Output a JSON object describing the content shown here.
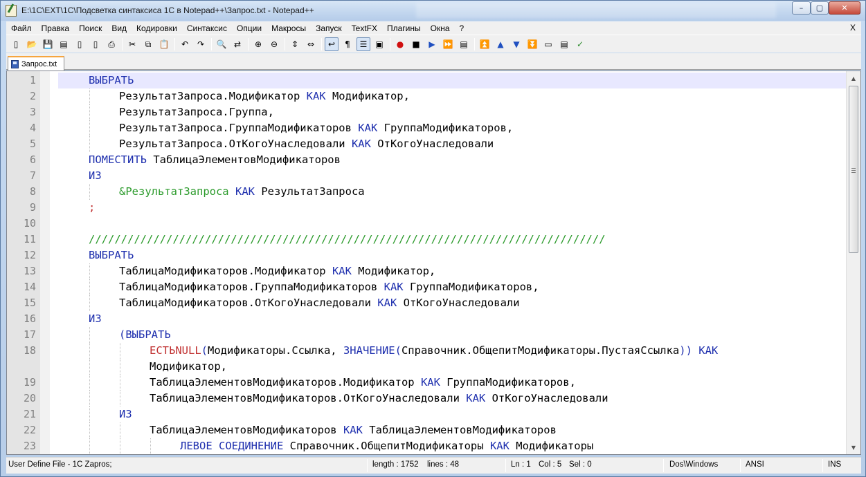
{
  "window": {
    "title": "E:\\1C\\EXT\\1C\\Подсветка синтаксиса 1С в Notepad++\\Запрос.txt - Notepad++",
    "minimize_glyph": "–",
    "maximize_glyph": "▢",
    "close_glyph": "✕"
  },
  "menu": {
    "items": [
      "Файл",
      "Правка",
      "Поиск",
      "Вид",
      "Кодировки",
      "Синтаксис",
      "Опции",
      "Макросы",
      "Запуск",
      "TextFX",
      "Плагины",
      "Окна",
      "?"
    ],
    "close_glyph": "X"
  },
  "toolbar": {
    "icons": [
      {
        "name": "new-file-icon",
        "glyph": "▯"
      },
      {
        "name": "open-file-icon",
        "glyph": "📂"
      },
      {
        "name": "save-icon",
        "glyph": "💾"
      },
      {
        "name": "save-all-icon",
        "glyph": "▤"
      },
      {
        "name": "close-file-icon",
        "glyph": "▯"
      },
      {
        "name": "close-all-icon",
        "glyph": "▯"
      },
      {
        "name": "print-icon",
        "glyph": "⎙"
      },
      {
        "sep": true
      },
      {
        "name": "cut-icon",
        "glyph": "✂"
      },
      {
        "name": "copy-icon",
        "glyph": "⧉"
      },
      {
        "name": "paste-icon",
        "glyph": "📋"
      },
      {
        "sep": true
      },
      {
        "name": "undo-icon",
        "glyph": "↶"
      },
      {
        "name": "redo-icon",
        "glyph": "↷"
      },
      {
        "sep": true
      },
      {
        "name": "find-icon",
        "glyph": "🔍"
      },
      {
        "name": "replace-icon",
        "glyph": "⇄"
      },
      {
        "sep": true
      },
      {
        "name": "zoom-in-icon",
        "glyph": "⊕"
      },
      {
        "name": "zoom-out-icon",
        "glyph": "⊖"
      },
      {
        "sep": true
      },
      {
        "name": "sync-vertical-icon",
        "glyph": "⇕"
      },
      {
        "name": "sync-horizontal-icon",
        "glyph": "⇔"
      },
      {
        "sep": true
      },
      {
        "name": "word-wrap-icon",
        "glyph": "↩",
        "active": true
      },
      {
        "name": "show-all-chars-icon",
        "glyph": "¶"
      },
      {
        "name": "indent-guide-icon",
        "glyph": "☰",
        "active": true
      },
      {
        "name": "language-icon",
        "glyph": "▣"
      },
      {
        "sep": true
      },
      {
        "name": "record-macro-icon",
        "glyph": "●",
        "color": "#d01010"
      },
      {
        "name": "stop-record-icon",
        "glyph": "■"
      },
      {
        "name": "play-macro-icon",
        "glyph": "▶",
        "color": "#2050c0"
      },
      {
        "name": "run-macro-multiple-icon",
        "glyph": "⏩",
        "color": "#2050c0"
      },
      {
        "name": "save-macro-icon",
        "glyph": "▤"
      },
      {
        "sep": true
      },
      {
        "name": "fold-all-icon",
        "glyph": "⏫",
        "color": "#2050c0"
      },
      {
        "name": "move-up-icon",
        "glyph": "▲",
        "color": "#2050c0"
      },
      {
        "name": "move-down-icon",
        "glyph": "▼",
        "color": "#2050c0"
      },
      {
        "name": "unfold-all-icon",
        "glyph": "⏬",
        "color": "#2050c0"
      },
      {
        "name": "panel-icon",
        "glyph": "▭"
      },
      {
        "name": "clipboard-history-icon",
        "glyph": "▤"
      },
      {
        "name": "spell-check-icon",
        "glyph": "✓",
        "color": "#2a8a2a"
      }
    ]
  },
  "tab": {
    "label": "Запрос.txt"
  },
  "editor": {
    "lines": [
      {
        "n": "1",
        "indent": 0,
        "current": true,
        "parts": [
          {
            "t": "ВЫБРАТЬ",
            "c": "kw"
          }
        ]
      },
      {
        "n": "2",
        "indent": 1,
        "parts": [
          {
            "t": "РезультатЗапроса.Модификатор "
          },
          {
            "t": "КАК",
            "c": "kw"
          },
          {
            "t": " Модификатор,"
          }
        ]
      },
      {
        "n": "3",
        "indent": 1,
        "parts": [
          {
            "t": "РезультатЗапроса.Группа,"
          }
        ]
      },
      {
        "n": "4",
        "indent": 1,
        "parts": [
          {
            "t": "РезультатЗапроса.ГруппаМодификаторов "
          },
          {
            "t": "КАК",
            "c": "kw"
          },
          {
            "t": " ГруппаМодификаторов,"
          }
        ]
      },
      {
        "n": "5",
        "indent": 1,
        "parts": [
          {
            "t": "РезультатЗапроса.ОтКогоУнаследовали "
          },
          {
            "t": "КАК",
            "c": "kw"
          },
          {
            "t": " ОтКогоУнаследовали"
          }
        ]
      },
      {
        "n": "6",
        "indent": 0,
        "parts": [
          {
            "t": "ПОМЕСТИТЬ",
            "c": "kw"
          },
          {
            "t": " ТаблицаЭлементовМодификаторов"
          }
        ]
      },
      {
        "n": "7",
        "indent": 0,
        "parts": [
          {
            "t": "ИЗ",
            "c": "kw"
          }
        ]
      },
      {
        "n": "8",
        "indent": 1,
        "parts": [
          {
            "t": "&РезультатЗапроса",
            "c": "cm"
          },
          {
            "t": " "
          },
          {
            "t": "КАК",
            "c": "kw"
          },
          {
            "t": " РезультатЗапроса"
          }
        ]
      },
      {
        "n": "9",
        "indent": 0,
        "parts": [
          {
            "t": ";",
            "c": "semi"
          }
        ]
      },
      {
        "n": "10",
        "indent": 0,
        "parts": []
      },
      {
        "n": "11",
        "indent": 0,
        "parts": [
          {
            "t": "////////////////////////////////////////////////////////////////////////////////",
            "c": "cm"
          }
        ]
      },
      {
        "n": "12",
        "indent": 0,
        "parts": [
          {
            "t": "ВЫБРАТЬ",
            "c": "kw"
          }
        ]
      },
      {
        "n": "13",
        "indent": 1,
        "parts": [
          {
            "t": "ТаблицаМодификаторов.Модификатор "
          },
          {
            "t": "КАК",
            "c": "kw"
          },
          {
            "t": " Модификатор,"
          }
        ]
      },
      {
        "n": "14",
        "indent": 1,
        "parts": [
          {
            "t": "ТаблицаМодификаторов.ГруппаМодификаторов "
          },
          {
            "t": "КАК",
            "c": "kw"
          },
          {
            "t": " ГруппаМодификаторов,"
          }
        ]
      },
      {
        "n": "15",
        "indent": 1,
        "parts": [
          {
            "t": "ТаблицаМодификаторов.ОтКогоУнаследовали "
          },
          {
            "t": "КАК",
            "c": "kw"
          },
          {
            "t": " ОтКогоУнаследовали"
          }
        ]
      },
      {
        "n": "16",
        "indent": 0,
        "parts": [
          {
            "t": "ИЗ",
            "c": "kw"
          }
        ]
      },
      {
        "n": "17",
        "indent": 1,
        "parts": [
          {
            "t": "(",
            "c": "par"
          },
          {
            "t": "ВЫБРАТЬ",
            "c": "kw"
          }
        ]
      },
      {
        "n": "18",
        "indent": 2,
        "parts": [
          {
            "t": "ЕСТЬNULL",
            "c": "fn"
          },
          {
            "t": "(",
            "c": "par"
          },
          {
            "t": "Модификаторы.Ссылка, "
          },
          {
            "t": "ЗНАЧЕНИЕ",
            "c": "kw"
          },
          {
            "t": "(",
            "c": "par"
          },
          {
            "t": "Справочник.ОбщепитМодификаторы.ПустаяСсылка"
          },
          {
            "t": "))",
            "c": "par"
          },
          {
            "t": " "
          },
          {
            "t": "КАК",
            "c": "kw"
          }
        ]
      },
      {
        "n": "",
        "indent": 2,
        "parts": [
          {
            "t": "Модификатор,"
          }
        ]
      },
      {
        "n": "19",
        "indent": 2,
        "parts": [
          {
            "t": "ТаблицаЭлементовМодификаторов.Модификатор "
          },
          {
            "t": "КАК",
            "c": "kw"
          },
          {
            "t": " ГруппаМодификаторов,"
          }
        ]
      },
      {
        "n": "20",
        "indent": 2,
        "parts": [
          {
            "t": "ТаблицаЭлементовМодификаторов.ОтКогоУнаследовали "
          },
          {
            "t": "КАК",
            "c": "kw"
          },
          {
            "t": " ОтКогоУнаследовали"
          }
        ]
      },
      {
        "n": "21",
        "indent": 1,
        "parts": [
          {
            "t": "ИЗ",
            "c": "kw"
          }
        ]
      },
      {
        "n": "22",
        "indent": 2,
        "parts": [
          {
            "t": "ТаблицаЭлементовМодификаторов "
          },
          {
            "t": "КАК",
            "c": "kw"
          },
          {
            "t": " ТаблицаЭлементовМодификаторов"
          }
        ]
      },
      {
        "n": "23",
        "indent": 3,
        "parts": [
          {
            "t": "ЛЕВОЕ СОЕДИНЕНИЕ",
            "c": "kw"
          },
          {
            "t": " Справочник.ОбщепитМодификаторы "
          },
          {
            "t": "КАК",
            "c": "kw"
          },
          {
            "t": " Модификаторы"
          }
        ]
      }
    ]
  },
  "scrollbar": {
    "up_glyph": "▲",
    "down_glyph": "▼"
  },
  "status": {
    "file_type": "User Define File - 1C Zapros;",
    "length": "length : 1752",
    "lines": "lines : 48",
    "ln": "Ln : 1",
    "col": "Col : 5",
    "sel": "Sel : 0",
    "eol": "Dos\\Windows",
    "encoding": "ANSI",
    "mode": "INS"
  },
  "colors": {
    "keyword": "#1e2fae",
    "function": "#c03030",
    "comment": "#2a9a2a",
    "current_line": "#e8e8ff"
  }
}
